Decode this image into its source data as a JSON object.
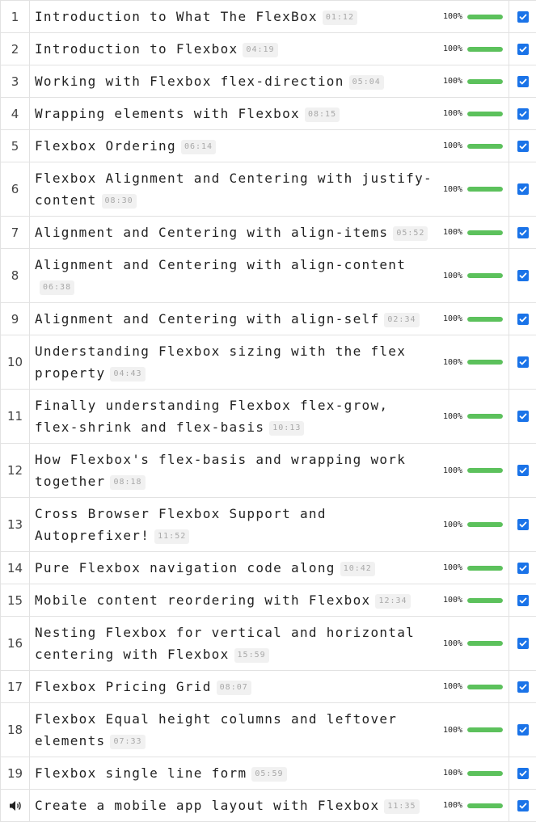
{
  "lessons": [
    {
      "num": "1",
      "title": "Introduction to What The FlexBox",
      "duration": "01:12",
      "percent_label": "100%",
      "progress": 1.0,
      "completed": true
    },
    {
      "num": "2",
      "title": "Introduction to Flexbox",
      "duration": "04:19",
      "percent_label": "100%",
      "progress": 1.0,
      "completed": true
    },
    {
      "num": "3",
      "title": "Working with Flexbox flex-direction",
      "duration": "05:04",
      "percent_label": "100%",
      "progress": 1.0,
      "completed": true
    },
    {
      "num": "4",
      "title": "Wrapping elements with Flexbox",
      "duration": "08:15",
      "percent_label": "100%",
      "progress": 1.0,
      "completed": true
    },
    {
      "num": "5",
      "title": "Flexbox Ordering",
      "duration": "06:14",
      "percent_label": "100%",
      "progress": 1.0,
      "completed": true
    },
    {
      "num": "6",
      "title": "Flexbox Alignment and Centering with justify-content",
      "duration": "08:30",
      "percent_label": "100%",
      "progress": 1.0,
      "completed": true
    },
    {
      "num": "7",
      "title": "Alignment and Centering with align-items",
      "duration": "05:52",
      "percent_label": "100%",
      "progress": 1.0,
      "completed": true
    },
    {
      "num": "8",
      "title": "Alignment and Centering with align-content",
      "duration": "06:38",
      "percent_label": "100%",
      "progress": 1.0,
      "completed": true
    },
    {
      "num": "9",
      "title": "Alignment and Centering with align-self",
      "duration": "02:34",
      "percent_label": "100%",
      "progress": 1.0,
      "completed": true
    },
    {
      "num": "10",
      "title": "Understanding Flexbox sizing with the flex property",
      "duration": "04:43",
      "percent_label": "100%",
      "progress": 1.0,
      "completed": true
    },
    {
      "num": "11",
      "title": "Finally understanding Flexbox flex-grow, flex-shrink and flex-basis",
      "duration": "10:13",
      "percent_label": "100%",
      "progress": 1.0,
      "completed": true
    },
    {
      "num": "12",
      "title": "How Flexbox's flex-basis and wrapping work together",
      "duration": "08:18",
      "percent_label": "100%",
      "progress": 1.0,
      "completed": true
    },
    {
      "num": "13",
      "title": "Cross Browser Flexbox Support and Autoprefixer!",
      "duration": "11:52",
      "percent_label": "100%",
      "progress": 1.0,
      "completed": true
    },
    {
      "num": "14",
      "title": "Pure Flexbox navigation code along",
      "duration": "10:42",
      "percent_label": "100%",
      "progress": 1.0,
      "completed": true
    },
    {
      "num": "15",
      "title": "Mobile content reordering with Flexbox",
      "duration": "12:34",
      "percent_label": "100%",
      "progress": 1.0,
      "completed": true
    },
    {
      "num": "16",
      "title": "Nesting Flexbox for vertical and horizontal centering with Flexbox",
      "duration": "15:59",
      "percent_label": "100%",
      "progress": 1.0,
      "completed": true
    },
    {
      "num": "17",
      "title": "Flexbox Pricing Grid",
      "duration": "08:07",
      "percent_label": "100%",
      "progress": 1.0,
      "completed": true
    },
    {
      "num": "18",
      "title": "Flexbox Equal height columns and leftover elements",
      "duration": "07:33",
      "percent_label": "100%",
      "progress": 1.0,
      "completed": true
    },
    {
      "num": "19",
      "title": "Flexbox single line form",
      "duration": "05:59",
      "percent_label": "100%",
      "progress": 1.0,
      "completed": true
    },
    {
      "num": "",
      "icon": "speaker-icon",
      "playing": true,
      "title": "Create a mobile app layout with Flexbox",
      "duration": "11:35",
      "percent_label": "100%",
      "progress": 1.0,
      "completed": true
    }
  ],
  "colors": {
    "progress_fill": "#5cc15c",
    "progress_track": "#e5e5e5",
    "checkbox": "#1a73e8",
    "border": "#e2e2e2"
  }
}
